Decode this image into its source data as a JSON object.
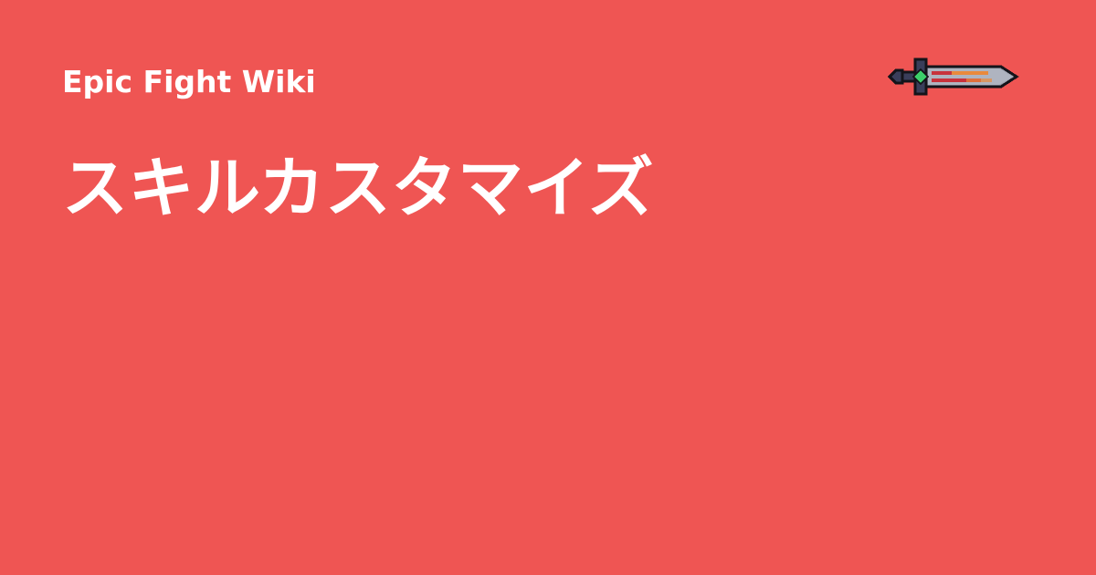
{
  "site": {
    "name": "Epic Fight Wiki"
  },
  "page": {
    "title": "スキルカスタマイズ"
  },
  "logo": {
    "icon": "sword-icon"
  },
  "colors": {
    "background": "#ef5553",
    "text": "#ffffff",
    "sword_outline": "#14141a",
    "sword_blade": "#9aa0ae",
    "sword_edge": "#c9cdd6",
    "sword_gem": "#3ccf6a",
    "sword_stripe_red": "#c8323c",
    "sword_stripe_orange": "#e98a3c",
    "sword_hilt": "#3a3e5a"
  }
}
